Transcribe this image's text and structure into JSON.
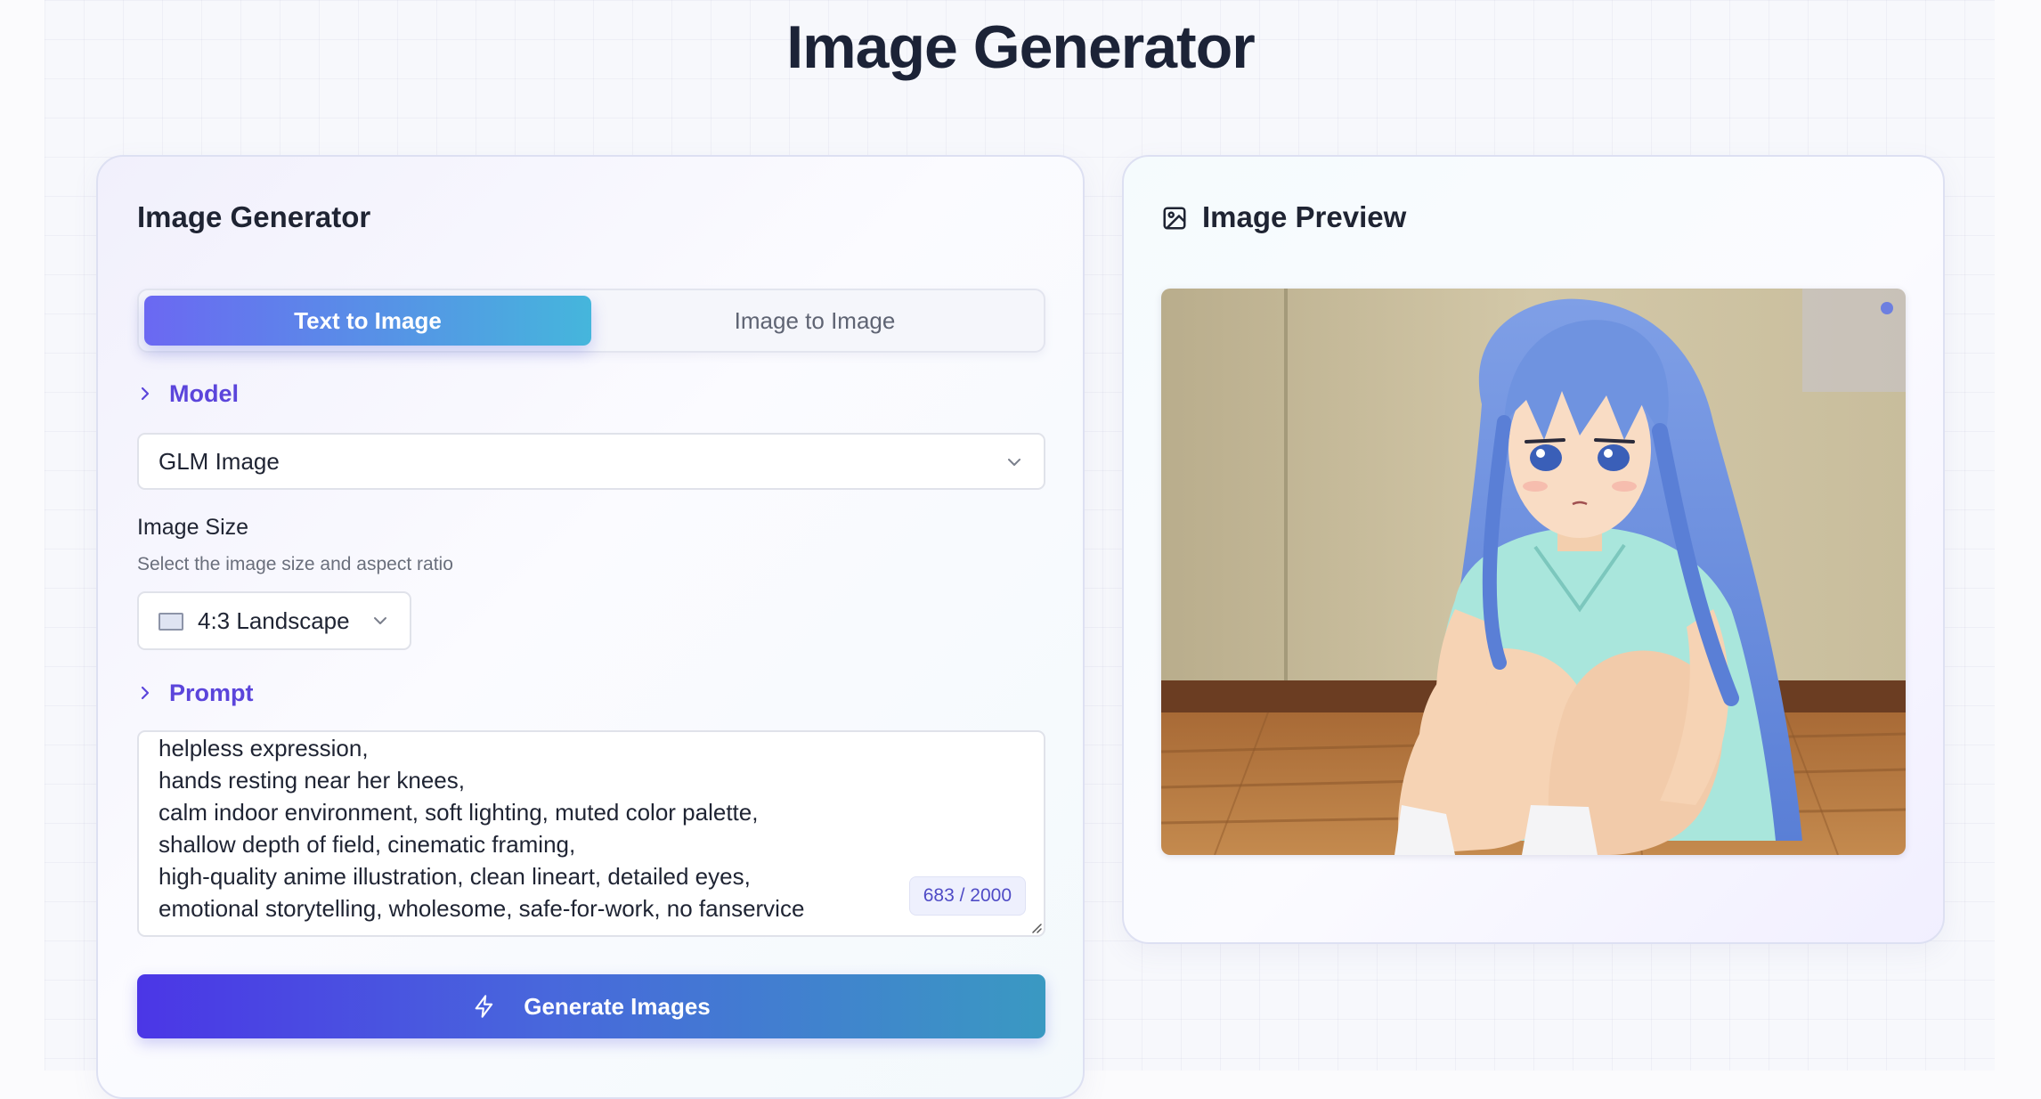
{
  "page": {
    "title": "Image Generator"
  },
  "generator": {
    "title": "Image Generator",
    "tabs": [
      {
        "label": "Text to Image",
        "active": true
      },
      {
        "label": "Image to Image",
        "active": false
      }
    ],
    "model": {
      "section_label": "Model",
      "selected": "GLM Image"
    },
    "image_size": {
      "label": "Image Size",
      "description": "Select the image size and aspect ratio",
      "selected": "4:3 Landscape"
    },
    "prompt": {
      "section_label": "Prompt",
      "visible_lines": [
        "helpless expression,",
        "hands resting near her knees,",
        "calm indoor environment, soft lighting, muted color palette,",
        "shallow depth of field, cinematic framing,",
        "high-quality anime illustration, clean lineart, detailed eyes,",
        "emotional storytelling, wholesome, safe-for-work, no fanservice"
      ],
      "counter": "683 / 2000"
    },
    "generate_label": "Generate Images"
  },
  "preview": {
    "title": "Image Preview",
    "icon": "image-icon"
  },
  "colors": {
    "accent_purple": "#5b45db",
    "tab_gradient_start": "#6b68f2",
    "tab_gradient_end": "#45b6dc",
    "button_gradient_start": "#4b36e6",
    "button_gradient_end": "#3a99c2"
  }
}
